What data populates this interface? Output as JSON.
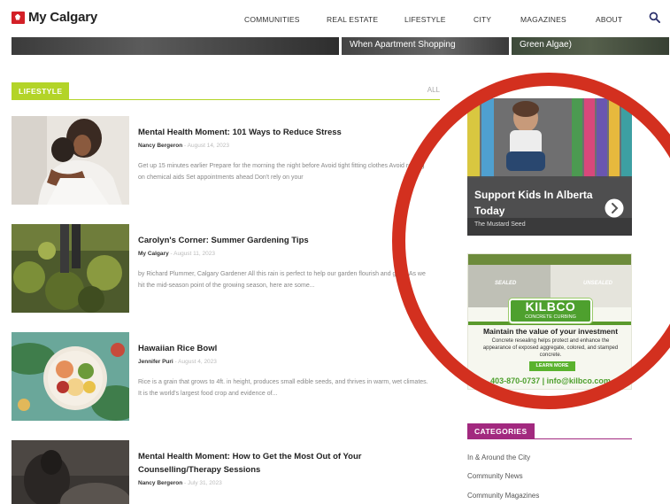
{
  "header": {
    "logo_text": "My Calgary",
    "nav": [
      "COMMUNITIES",
      "REAL ESTATE",
      "LIFESTYLE",
      "CITY",
      "MAGAZINES",
      "ABOUT"
    ]
  },
  "hero": {
    "captions": [
      "",
      "When Apartment Shopping",
      "Green Algae)"
    ]
  },
  "section": {
    "tag": "LIFESTYLE",
    "all_link": "ALL"
  },
  "articles": [
    {
      "title": "Mental Health Moment: 101 Ways to Reduce Stress",
      "author": "Nancy Bergeron",
      "date": "August 14, 2023",
      "excerpt": "Get up 15 minutes earlier Prepare for the morning the night before Avoid tight fitting clothes Avoid relying on chemical aids Set appointments ahead Don't rely on your"
    },
    {
      "title": "Carolyn's Corner: Summer Gardening Tips",
      "author": "My Calgary",
      "date": "August 11, 2023",
      "excerpt": "by Richard Plummer, Calgary Gardener All this rain is perfect to help our garden flourish and grow. As we hit the mid-season point of the growing season, here are some..."
    },
    {
      "title": "Hawaiian Rice Bowl",
      "author": "Jennifer Puri",
      "date": "August 4, 2023",
      "excerpt": "Rice is a grain that grows to 4ft. in height, produces small edible seeds, and thrives in warm, wet climates. It is the world's largest food crop and evidence of..."
    },
    {
      "title": "Mental Health Moment: How to Get the Most Out of Your Counselling/Therapy Sessions",
      "author": "Nancy Bergeron",
      "date": "July 31, 2023",
      "excerpt": ""
    }
  ],
  "sidebar": {
    "ad1": {
      "title": "Support Kids In Alberta Today",
      "source": "The Mustard Seed"
    },
    "ad2": {
      "label_left": "SEALED",
      "label_right": "UNSEALED",
      "brand": "KILBCO",
      "brand_sub": "CONCRETE CURBING",
      "headline": "Maintain the value of your investment",
      "body": "Concrete resealing helps protect and enhance the appearance of exposed aggregate, colored, and stamped concrete.",
      "cta": "LEARN MORE",
      "contact": "403-870-0737 | info@kilbco.com"
    },
    "categories_tag": "CATEGORIES",
    "categories": [
      "In & Around the City",
      "Community News",
      "Community Magazines"
    ]
  },
  "colors": {
    "lifestyle_accent": "#b3d428",
    "categories_accent": "#a2297f",
    "circle": "#d3301f",
    "brand_red": "#d32027"
  }
}
